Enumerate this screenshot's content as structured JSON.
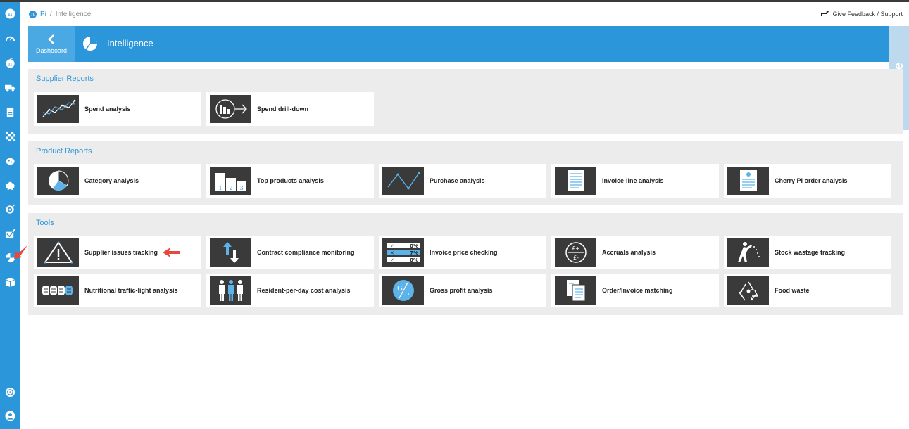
{
  "breadcrumb": {
    "home": "Pi",
    "separator": "/",
    "current": "Intelligence"
  },
  "feedback": {
    "label": "Give Feedback / Support"
  },
  "header": {
    "back_label": "Dashboard",
    "title": "Intelligence"
  },
  "watermark": {
    "text": "Demo Site"
  },
  "sidebar": {
    "items": [
      {
        "icon": "pi-logo-icon"
      },
      {
        "icon": "dashboard-gauge-icon"
      },
      {
        "icon": "pi-apple-icon"
      },
      {
        "icon": "truck-icon"
      },
      {
        "icon": "document-icon"
      },
      {
        "icon": "checkerboard-icon"
      },
      {
        "icon": "cow-icon"
      },
      {
        "icon": "piggy-bank-icon"
      },
      {
        "icon": "target-icon"
      },
      {
        "icon": "checked-box-icon"
      },
      {
        "icon": "intelligence-pie-icon"
      },
      {
        "icon": "box-icon"
      },
      {
        "icon": "chat-help-icon"
      },
      {
        "icon": "user-icon"
      }
    ]
  },
  "sections": {
    "supplier": {
      "title": "Supplier Reports",
      "cards": [
        "Spend analysis",
        "Spend drill-down"
      ]
    },
    "product": {
      "title": "Product Reports",
      "cards": [
        "Category analysis",
        "Top products analysis",
        "Purchase analysis",
        "Invoice-line analysis",
        "Cherry Pi order analysis"
      ]
    },
    "tools": {
      "title": "Tools",
      "cards": [
        "Supplier issues tracking",
        "Contract compliance monitoring",
        "Invoice price checking",
        "Accruals analysis",
        "Stock wastage tracking",
        "Nutritional traffic-light analysis",
        "Resident-per-day cost analysis",
        "Gross profit analysis",
        "Order/Invoice matching",
        "Food waste"
      ]
    }
  },
  "thumb_text": {
    "top_products": [
      "1",
      "2",
      "3"
    ],
    "price_check": [
      "0%",
      "7%",
      "0%"
    ],
    "accruals": [
      "£+",
      "£-"
    ],
    "gross_profit": [
      "G",
      "P"
    ]
  },
  "colors": {
    "accent": "#2b96d9",
    "panel": "#ececec",
    "thumb": "#3a3a3a",
    "annotation": "#e8473b"
  }
}
